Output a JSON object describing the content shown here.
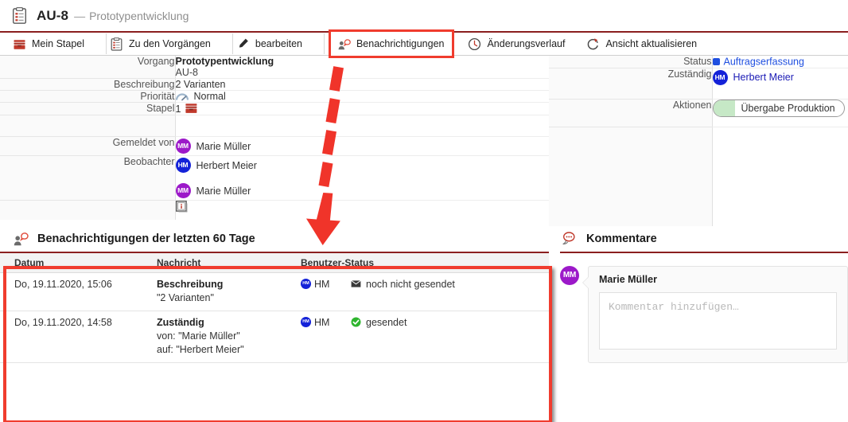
{
  "header": {
    "icon": "clipboard-icon",
    "key": "AU-8",
    "dash": "—",
    "name": "Prototypentwicklung"
  },
  "toolbar": {
    "items": [
      {
        "icon": "stack-box-icon",
        "label": "Mein Stapel",
        "highlighted": false
      },
      {
        "icon": "clipboard-icon",
        "label": "Zu den Vorgängen",
        "highlighted": false
      },
      {
        "icon": "pencil-icon",
        "label": "bearbeiten",
        "highlighted": false
      },
      {
        "icon": "notification-icon",
        "label": "Benachrichtigungen",
        "highlighted": true
      },
      {
        "icon": "clock-icon",
        "label": "Änderungsverlauf",
        "highlighted": false
      },
      {
        "icon": "refresh-icon",
        "label": "Ansicht aktualisieren",
        "highlighted": false
      }
    ]
  },
  "details_left": {
    "vorgang_label": "Vorgang",
    "vorgang_title": "Prototypentwicklung",
    "vorgang_key": "AU-8",
    "beschreibung_label": "Beschreibung",
    "beschreibung_value": "2 Varianten",
    "prioritaet_label": "Priorität",
    "prioritaet_value": "Normal",
    "prioritaet_icon": "priority-gauge-icon",
    "stapel_label": "Stapel",
    "stapel_value": "1",
    "stapel_icon": "stack-box-icon",
    "gemeldet_label": "Gemeldet von",
    "gemeldet_person": {
      "initials": "MM",
      "name": "Marie Müller",
      "color": "#9c19c9"
    },
    "beobachter_label": "Beobachter",
    "beobachter": [
      {
        "initials": "HM",
        "name": "Herbert Meier",
        "color": "#1422d8"
      },
      {
        "initials": "MM",
        "name": "Marie Müller",
        "color": "#9c19c9"
      }
    ],
    "info_icon": "info-icon"
  },
  "details_right": {
    "status_label": "Status",
    "status_value": "Auftragserfassung",
    "status_color": "#1f4fe0",
    "zustaendig_label": "Zuständig",
    "zustaendig_person": {
      "initials": "HM",
      "name": "Herbert Meier",
      "color": "#1422d8"
    },
    "aktionen_label": "Aktionen",
    "aktionen_button": "Übergabe Produktion",
    "aktionen_accent": "#c6e8c6"
  },
  "notifications": {
    "icon": "notification-person-icon",
    "title": "Benachrichtigungen der letzten 60 Tage",
    "columns": [
      "Datum",
      "Nachricht",
      "Benutzer-Status"
    ],
    "rows": [
      {
        "date": "Do, 19.11.2020, 15:06",
        "msg_title": "Beschreibung",
        "msg_lines": [
          "\"2 Varianten\""
        ],
        "user_initials": "HM",
        "user_label": "HM",
        "state": "noch nicht gesendet",
        "state_icon": "envelope-icon",
        "state_color": "#333333"
      },
      {
        "date": "Do, 19.11.2020, 14:58",
        "msg_title": "Zuständig",
        "msg_lines": [
          "von: \"Marie Müller\"",
          "auf: \"Herbert Meier\""
        ],
        "user_initials": "HM",
        "user_label": "HM",
        "state": "gesendet",
        "state_icon": "check-circle-icon",
        "state_color": "#2fb52f"
      }
    ]
  },
  "comments": {
    "icon": "comment-bubble-icon",
    "title": "Kommentare",
    "author": {
      "initials": "MM",
      "name": "Marie Müller",
      "color": "#9c19c9"
    },
    "input_value": "",
    "input_placeholder": "Kommentar hinzufügen…"
  },
  "annotations": {
    "highlight_color": "#f03c2e",
    "arrow": "dashed-down-arrow",
    "boxes": [
      "toolbar-benachrichtigungen",
      "notifications-panel"
    ]
  }
}
